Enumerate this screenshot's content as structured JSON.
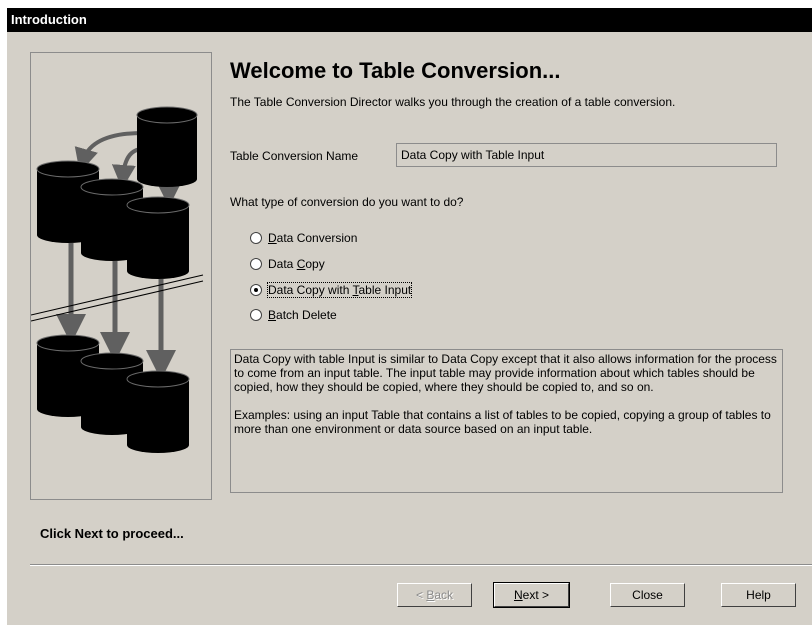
{
  "window": {
    "title": "Introduction"
  },
  "main": {
    "heading": "Welcome to Table Conversion...",
    "subtitle": "The Table Conversion Director walks you through the creation of a table conversion.",
    "name_label": "Table Conversion Name",
    "name_value": "Data Copy with Table Input",
    "question": "What type of conversion do you want to do?",
    "options": [
      {
        "pre": "",
        "key": "D",
        "post": "ata Conversion",
        "label": "Data Conversion",
        "selected": false
      },
      {
        "pre": "Data ",
        "key": "C",
        "post": "opy",
        "label": "Data Copy",
        "selected": false
      },
      {
        "pre": "Data Copy with ",
        "key": "T",
        "post": "able Input",
        "label": "Data Copy with Table Input",
        "selected": true
      },
      {
        "pre": "",
        "key": "B",
        "post": "atch Delete",
        "label": "Batch Delete",
        "selected": false
      }
    ],
    "description": {
      "paragraph1": "Data Copy with table Input is similar to Data Copy except that it also allows information for the process to come from an input table.  The input table may provide information about which tables should be copied, how they should be copied, where they should be copied to, and so on.",
      "paragraph2": "Examples: using an input Table that contains a list of tables to be copied, copying a group of tables to more than one environment or data source based on an input table."
    }
  },
  "footer": {
    "hint": "Click Next to proceed..."
  },
  "buttons": {
    "back": {
      "pre": "< ",
      "key": "B",
      "post": "ack",
      "enabled": false
    },
    "next": {
      "pre": "",
      "key": "N",
      "post": "ext >",
      "enabled": true
    },
    "close": "Close",
    "help": "Help"
  },
  "colors": {
    "dialog_bg": "#d4d0c8",
    "title_bg": "#000000",
    "title_text": "#ffffff",
    "cylinder": "#000000",
    "arrow": "#606060"
  }
}
